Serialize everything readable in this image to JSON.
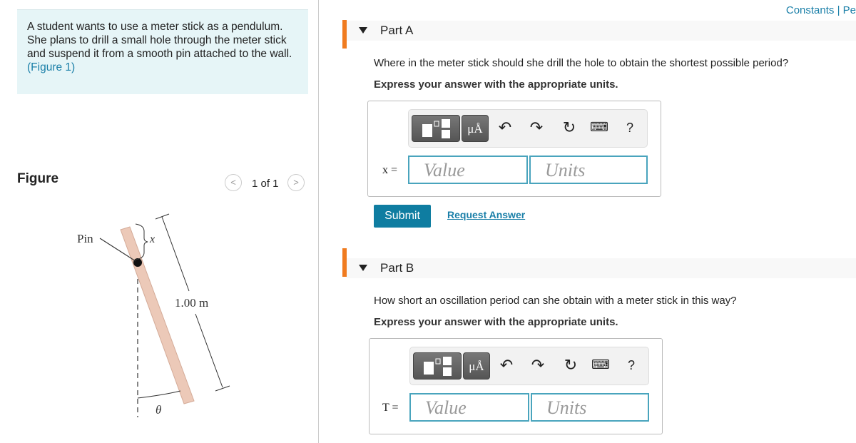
{
  "problem": {
    "text": "A student wants to use a meter stick as a pendulum. She plans to drill a small hole through the meter stick and suspend it from a smooth pin attached to the wall.",
    "figure_link": "(Figure 1)"
  },
  "header": {
    "constants": "Constants | Pe"
  },
  "figure": {
    "title": "Figure",
    "pagination": "1 of 1",
    "labels": {
      "pin": "Pin",
      "x": "x",
      "length": "1.00 m",
      "theta": "θ"
    }
  },
  "parts": [
    {
      "label": "Part A",
      "question": "Where in the meter stick should she drill the hole to obtain the shortest possible period?",
      "instruction": "Express your answer with the appropriate units.",
      "variable": "x =",
      "value_placeholder": "Value",
      "units_placeholder": "Units",
      "submit": "Submit",
      "request": "Request Answer"
    },
    {
      "label": "Part B",
      "question": "How short an oscillation period can she obtain with a meter stick in this way?",
      "instruction": "Express your answer with the appropriate units.",
      "variable": "T =",
      "value_placeholder": "Value",
      "units_placeholder": "Units"
    }
  ],
  "toolbar": {
    "units_btn": "μÅ",
    "help": "?",
    "icons": [
      "templates-icon",
      "units-icon",
      "undo-icon",
      "redo-icon",
      "reset-icon",
      "keyboard-icon",
      "help-icon"
    ]
  },
  "colors": {
    "accent": "#0f7da1",
    "part_marker": "#f07b1f",
    "problem_bg": "#e6f5f7"
  }
}
